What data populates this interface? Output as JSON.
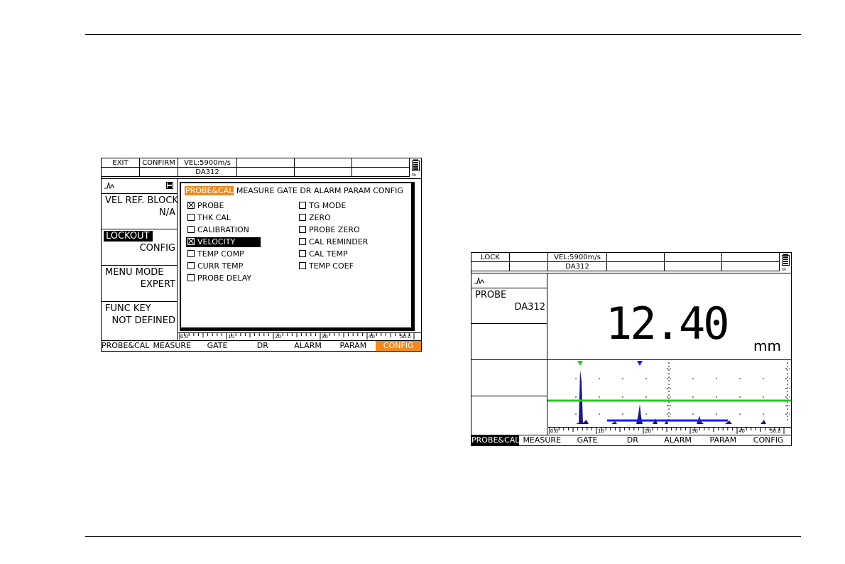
{
  "left_screen": {
    "header": {
      "exit": "EXIT",
      "confirm": "CONFIRM",
      "velocity": "VEL:5900m/s",
      "probe": "DA312"
    },
    "params": [
      {
        "title": "VEL REF. BLOCK",
        "value": "N/A"
      },
      {
        "title": "LOCKOUT",
        "value": "CONFIG",
        "selected": true
      },
      {
        "title": "MENU MODE",
        "value": "EXPERT"
      },
      {
        "title": "FUNC KEY",
        "value": "NOT DEFINED"
      }
    ],
    "dialog": {
      "tabs": [
        "PROBE&CAL",
        "MEASURE",
        "GATE",
        "DR",
        "ALARM",
        "PARAM",
        "CONFIG"
      ],
      "left_items": [
        {
          "label": "PROBE",
          "checked": true
        },
        {
          "label": "THK CAL",
          "checked": false
        },
        {
          "label": "CALIBRATION",
          "checked": false
        },
        {
          "label": "VELOCITY",
          "checked": true,
          "selected": true
        },
        {
          "label": "TEMP COMP",
          "checked": false
        },
        {
          "label": "CURR TEMP",
          "checked": false
        },
        {
          "label": "PROBE DELAY",
          "checked": false
        }
      ],
      "right_items": [
        {
          "label": "TG MODE",
          "checked": false
        },
        {
          "label": "ZERO",
          "checked": false
        },
        {
          "label": "PROBE ZERO",
          "checked": false
        },
        {
          "label": "CAL REMINDER",
          "checked": false
        },
        {
          "label": "CAL TEMP",
          "checked": false
        },
        {
          "label": "TEMP COEF",
          "checked": false
        }
      ]
    },
    "ruler": [
      "0.0",
      "10",
      "20",
      "30",
      "40",
      "50.0"
    ],
    "menu": [
      "PROBE&CAL",
      "MEASURE",
      "GATE",
      "DR",
      "ALARM",
      "PARAM",
      "CONFIG"
    ],
    "active_menu": "CONFIG"
  },
  "right_screen": {
    "header": {
      "lock": "LOCK",
      "velocity": "VEL:5900m/s",
      "probe": "DA312"
    },
    "params": [
      {
        "title": "PROBE",
        "value": "DA312"
      }
    ],
    "reading": "12.40",
    "unit": "mm",
    "ruler": [
      "0.0",
      "10",
      "20",
      "30",
      "40",
      "50.0"
    ],
    "menu": [
      "PROBE&CAL",
      "MEASURE",
      "GATE",
      "DR",
      "ALARM",
      "PARAM",
      "CONFIG"
    ],
    "active_menu": "PROBE&CAL"
  },
  "colors": {
    "accent": "#ee8a1e",
    "gate_green": "#22cc22",
    "gate_blue": "#1a1aff",
    "signal": "#1a1a80"
  }
}
